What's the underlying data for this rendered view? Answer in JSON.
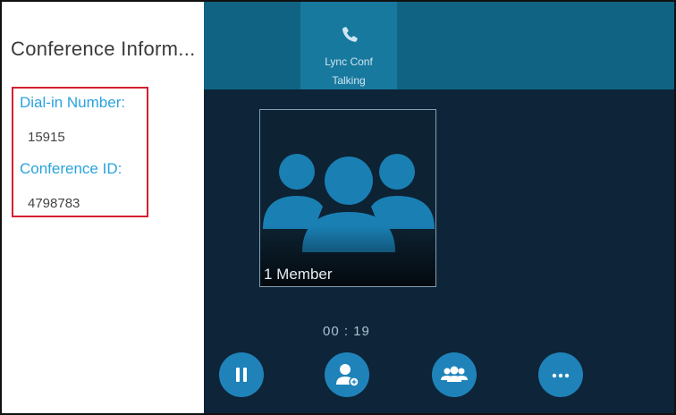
{
  "conference": {
    "title": "Conference  Inform...",
    "dialin_label": "Dial-in Number:",
    "dialin_value": "15915",
    "confid_label": "Conference ID:",
    "confid_value": "4798783"
  },
  "call": {
    "tab_name": "Lync Conf",
    "tab_status": "Talking",
    "member_count": "1 Member",
    "timer": "00 : 19"
  },
  "controls": [
    "hold",
    "add-participant",
    "manage-members",
    "more"
  ],
  "colors": {
    "accent": "#2aa3dd",
    "highlight_border": "#d4202f",
    "dark_bg": "#0e2438",
    "topbar": "#116383",
    "button": "#1f83ba"
  }
}
